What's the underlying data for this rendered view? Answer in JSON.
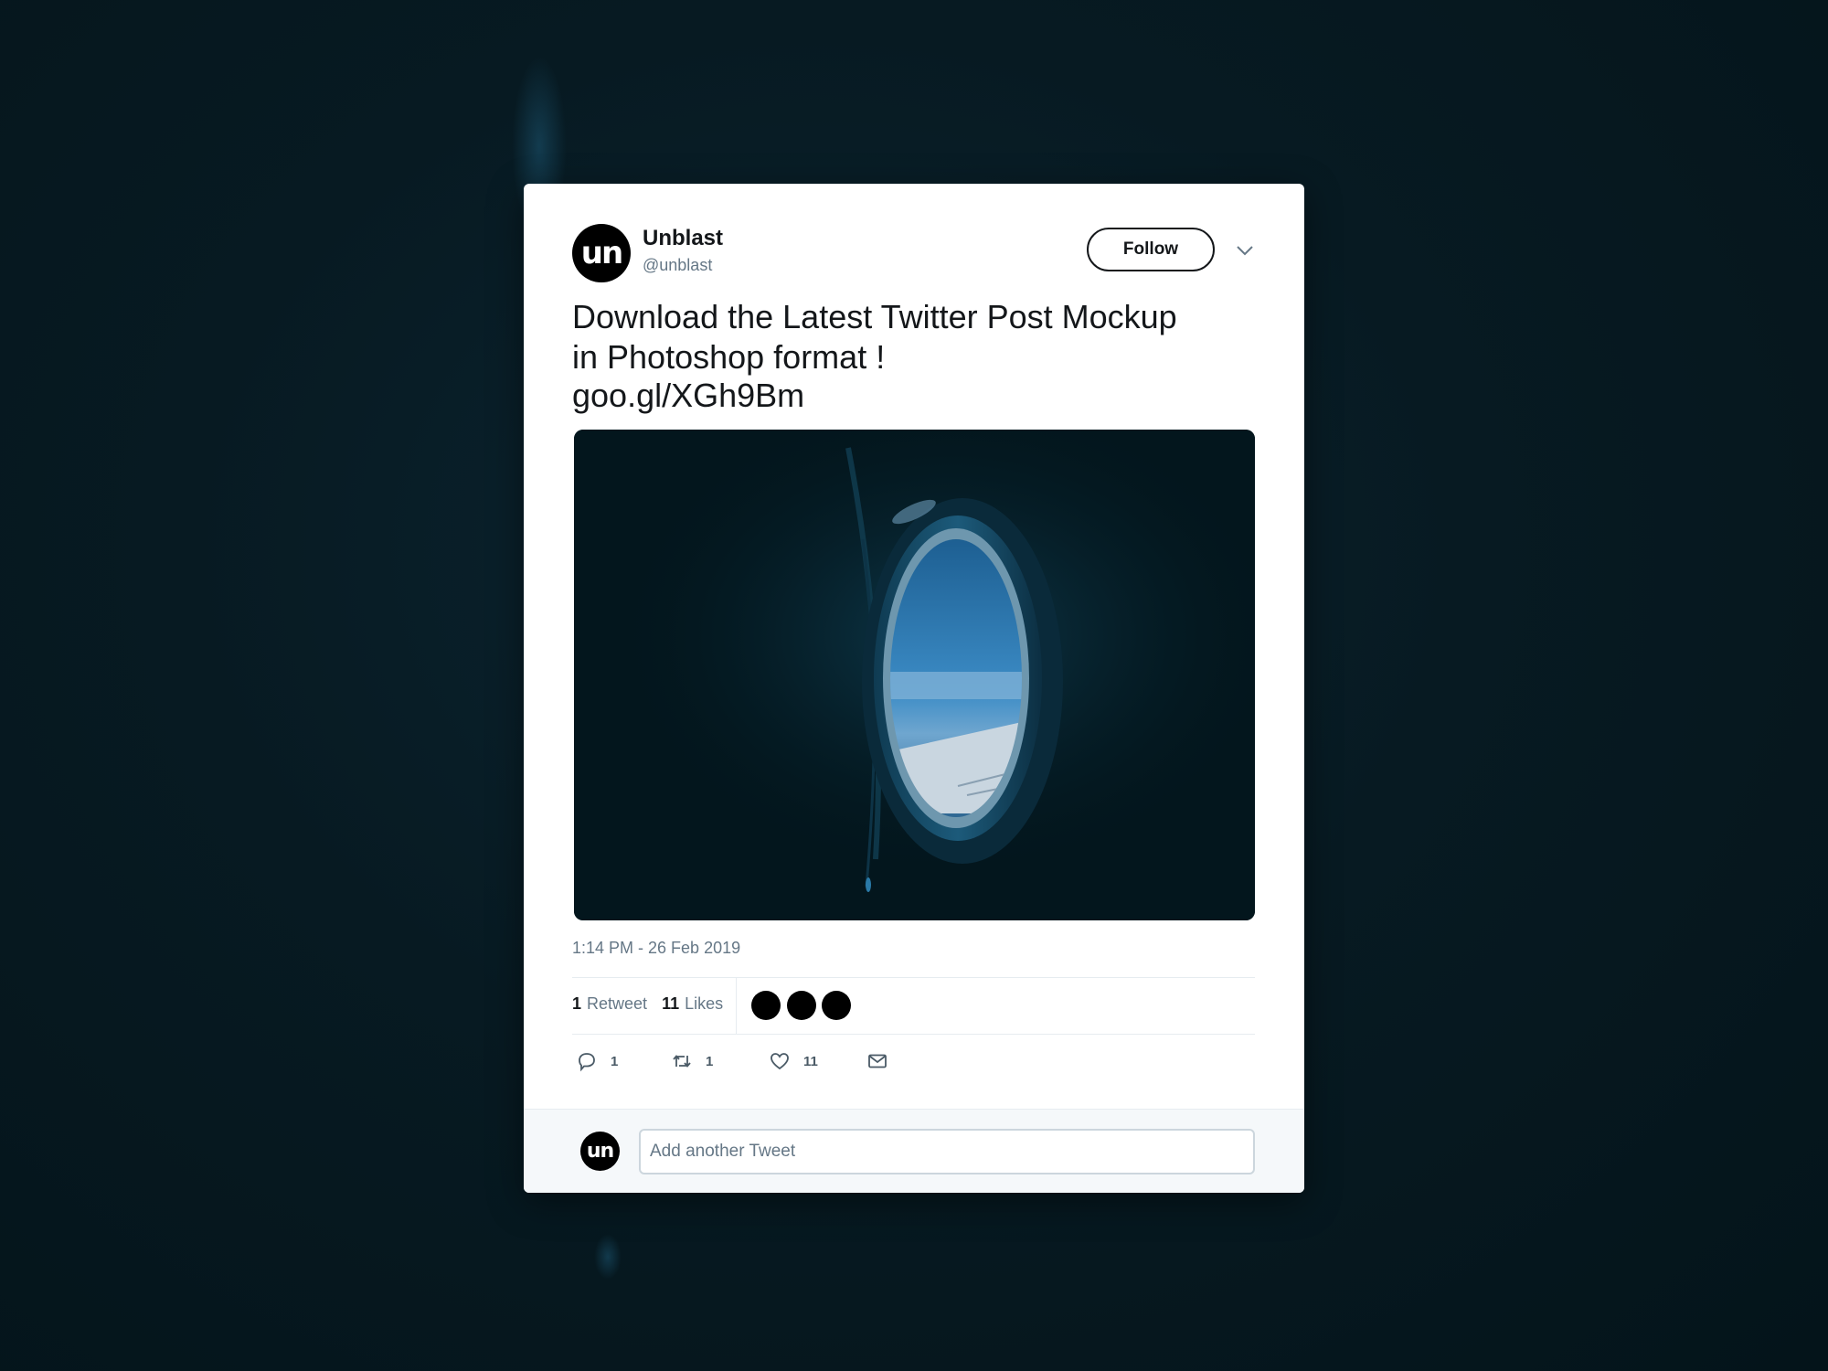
{
  "tweet": {
    "avatar_text": "un",
    "display_name": "Unblast",
    "handle": "@unblast",
    "follow_label": "Follow",
    "text_lines": [
      "Download the Latest Twitter Post Mockup",
      "in Photoshop format !",
      "goo.gl/XGh9Bm"
    ],
    "timestamp": "1:14 PM - 26 Feb 2019",
    "stats": {
      "retweets_count": "1",
      "retweets_label": "Retweet",
      "likes_count": "11",
      "likes_label": "Likes"
    },
    "actions": {
      "reply_count": "1",
      "retweet_count": "1",
      "like_count": "11"
    },
    "icons": {
      "caret": "chevron-down-icon",
      "reply": "reply-icon",
      "retweet": "retweet-icon",
      "like": "heart-icon",
      "dm": "envelope-icon"
    }
  },
  "reply_box": {
    "avatar_text": "un",
    "placeholder": "Add another Tweet"
  },
  "colors": {
    "background": "#071a22",
    "card": "#ffffff",
    "text_primary": "#14171a",
    "text_secondary": "#657786",
    "reply_bar": "#f5f8fa"
  }
}
